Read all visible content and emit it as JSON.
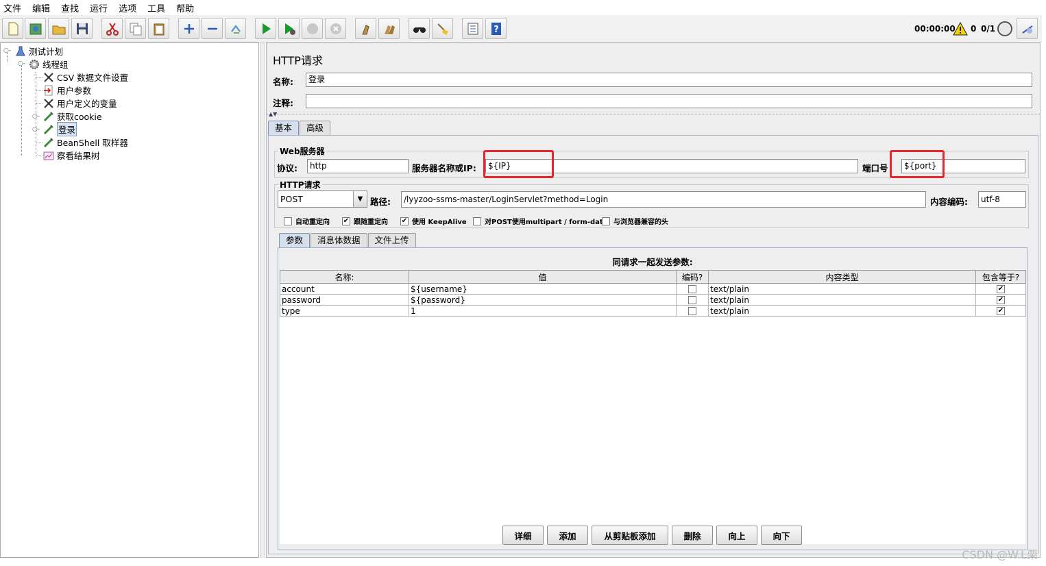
{
  "menu": [
    "文件",
    "编辑",
    "查找",
    "运行",
    "选项",
    "工具",
    "帮助"
  ],
  "toolbar": {
    "buttons": [
      "new-icon",
      "templates-icon",
      "open-icon",
      "save-icon",
      "cut-icon",
      "copy-icon",
      "paste-icon",
      "expand-icon",
      "collapse-icon",
      "toggle-icon",
      "start-icon",
      "start-no-pause-icon",
      "stop-icon",
      "shutdown-icon",
      "clear-icon",
      "clear-all-icon",
      "search-icon",
      "reset-search-icon",
      "function-helper-icon",
      "help-icon"
    ],
    "timer": "00:00:00",
    "warnings": "0",
    "threads": "0/1"
  },
  "tree": {
    "items": [
      {
        "label": "测试计划"
      },
      {
        "label": "线程组"
      },
      {
        "label": "CSV 数据文件设置"
      },
      {
        "label": "用户参数"
      },
      {
        "label": "用户定义的变量"
      },
      {
        "label": "获取cookie"
      },
      {
        "label": "登录"
      },
      {
        "label": "BeanShell 取样器"
      },
      {
        "label": "察看结果树"
      }
    ]
  },
  "panel": {
    "title": "HTTP请求",
    "name_label": "名称:",
    "name_value": "登录",
    "comment_label": "注释:",
    "comment_value": "",
    "tabs": [
      "基本",
      "高级"
    ],
    "web_server": {
      "group_title": "Web服务器",
      "protocol_label": "协议:",
      "protocol_value": "http",
      "server_label": "服务器名称或IP:",
      "server_value": "${IP}",
      "port_label": "端口号",
      "port_value": "${port}"
    },
    "http_request": {
      "group_title": "HTTP请求",
      "method": "POST",
      "path_label": "路径:",
      "path_value": "/lyyzoo-ssms-master/LoginServlet?method=Login",
      "encoding_label": "内容编码:",
      "encoding_value": "utf-8"
    },
    "options": [
      {
        "label": "自动重定向",
        "checked": false
      },
      {
        "label": "跟随重定向",
        "checked": true
      },
      {
        "label": "使用 KeepAlive",
        "checked": true
      },
      {
        "label": "对POST使用multipart / form-data",
        "checked": false
      },
      {
        "label": "与浏览器兼容的头",
        "checked": false
      }
    ],
    "sub_tabs": [
      "参数",
      "消息体数据",
      "文件上传"
    ],
    "params_title": "同请求一起发送参数:",
    "columns": [
      "名称:",
      "值",
      "编码?",
      "内容类型",
      "包含等于?"
    ],
    "rows": [
      {
        "name": "account",
        "value": "${username}",
        "encode": false,
        "type": "text/plain",
        "include_equals": true
      },
      {
        "name": "password",
        "value": "${password}",
        "encode": false,
        "type": "text/plain",
        "include_equals": true
      },
      {
        "name": "type",
        "value": "1",
        "encode": false,
        "type": "text/plain",
        "include_equals": true
      }
    ],
    "buttons": [
      "详细",
      "添加",
      "从剪贴板添加",
      "删除",
      "向上",
      "向下"
    ]
  },
  "watermark": "CSDN @W.L栗",
  "colors": {
    "highlight": "#e8262a",
    "selected_tab": "#d5e0ec",
    "panel_bg": "#eeeeee"
  }
}
